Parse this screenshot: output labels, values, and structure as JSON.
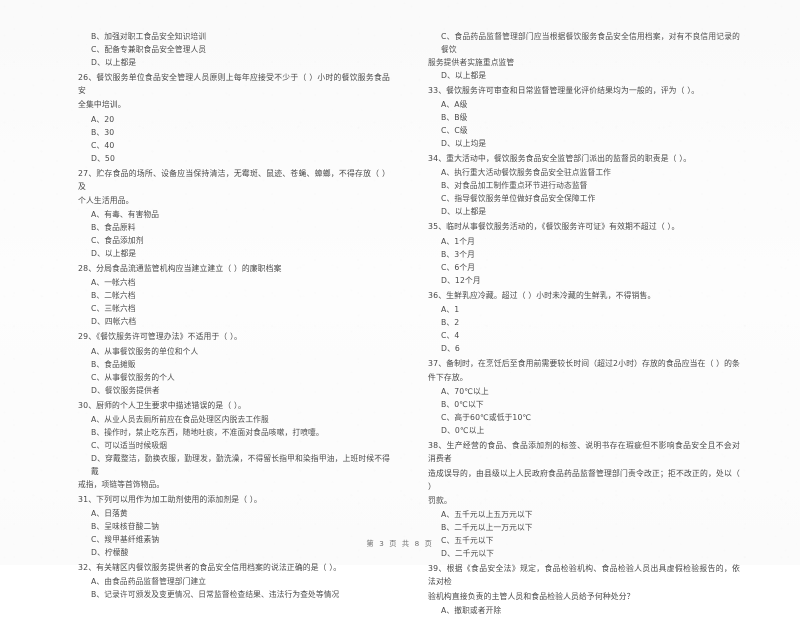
{
  "document": {
    "kind": "scanned-exam-page",
    "language": "zh-CN",
    "footer": {
      "prefix": "第",
      "page_number": "3",
      "middle": "页 共",
      "total_pages": "8",
      "suffix": "页",
      "full_text": "第 3 页 共 8 页"
    }
  },
  "columns": [
    {
      "id": "left-column",
      "blocks": [
        {
          "type": "options-continued",
          "options": [
            "B、加强对职工食品安全知识培训",
            "C、配备专兼职食品安全管理人员",
            "D、以上都是"
          ]
        },
        {
          "type": "question",
          "number": "26",
          "stem": "26、餐饮服务单位食品安全管理人员原则上每年应接受不少于（      ）小时的餐饮服务食品安",
          "stem_cont": "全集中培训。",
          "options": [
            "A、20",
            "B、30",
            "C、40",
            "D、50"
          ]
        },
        {
          "type": "question",
          "number": "27",
          "stem": "27、贮存食品的场所、设备应当保持清洁，无霉斑、鼠迹、苍蝇、蟑螂，不得存放（      ）及",
          "stem_cont": "个人生活用品。",
          "options": [
            "A、有毒、有害物品",
            "B、食品原料",
            "C、食品添加剂",
            "D、以上都是"
          ]
        },
        {
          "type": "question",
          "number": "28",
          "stem": "28、分局食品流通监管机构应当建立建立（      ）的廉职档案",
          "options": [
            "A、一帐六档",
            "B、二帐六档",
            "C、三帐六档",
            "D、四帐六档"
          ]
        },
        {
          "type": "question",
          "number": "29",
          "stem": "29、《餐饮服务许可管理办法》不适用于（      ）。",
          "options": [
            "A、从事餐饮服务的单位和个人",
            "B、食品摊贩",
            "C、从事餐饮服务的个人",
            "D、餐饮服务提供者"
          ]
        },
        {
          "type": "question",
          "number": "30",
          "stem": "30、厨师的个人卫生要求中描述错误的是（      ）。",
          "options": [
            "A、从业人员去厕所前应在食品处理区内脱去工作服",
            "B、操作时，禁止吃东西，随地吐痰，不准面对食品咳嗽，打喷嚏。",
            "C、可以适当时候吸烟",
            "D、穿戴整洁，勤换衣服，勤理发，勤洗澡，不得留长指甲和染指甲油，上班时候不得戴"
          ],
          "option_cont": "戒指，项链等首饰物品。"
        },
        {
          "type": "question",
          "number": "31",
          "stem": "31、下列可以用作为加工助剂使用的添加剂是（      ）。",
          "options": [
            "A、日落黄",
            "B、呈味核苷酸二钠",
            "C、羧甲基纤维素钠",
            "D、柠檬酸"
          ]
        },
        {
          "type": "question",
          "number": "32",
          "stem": "32、有关辖区内餐饮服务提供者的食品安全信用档案的说法正确的是（      ）。",
          "options": [
            "A、由食品药品监督管理部门建立",
            "B、记录许可颁发及变更情况、日常监督检查结果、违法行为查处等情况"
          ]
        }
      ]
    },
    {
      "id": "right-column",
      "blocks": [
        {
          "type": "options-continued",
          "options": [
            "C、食品药品监督管理部门应当根据餐饮服务食品安全信用档案，对有不良信用记录的餐饮"
          ],
          "option_cont": "服务提供者实施重点监管",
          "options_after": [
            "D、以上都是"
          ]
        },
        {
          "type": "question",
          "number": "33",
          "stem": "33、餐饮服务许可审查和日常监督管理量化评价结果均为一般的，评为（      ）。",
          "options": [
            "A、A级",
            "B、B级",
            "C、C级",
            "D、以上均是"
          ]
        },
        {
          "type": "question",
          "number": "34",
          "stem": "34、重大活动中，餐饮服务食品安全监管部门派出的监督员的职责是（      ）。",
          "options": [
            "A、执行重大活动餐饮服务食品安全驻点监督工作",
            "B、对食品加工制作重点环节进行动态监督",
            "C、指导餐饮服务单位做好食品安全保障工作",
            "D、以上都是"
          ]
        },
        {
          "type": "question",
          "number": "35",
          "stem": "35、临时从事餐饮服务活动的，《餐饮服务许可证》有效期不超过（      ）。",
          "options": [
            "A、1个月",
            "B、3个月",
            "C、6个月",
            "D、12个月"
          ]
        },
        {
          "type": "question",
          "number": "36",
          "stem": "36、生鲜乳应冷藏。超过（      ）小时未冷藏的生鲜乳，不得销售。",
          "options": [
            "A、1",
            "B、2",
            "C、4",
            "D、6"
          ]
        },
        {
          "type": "question",
          "number": "37",
          "stem": "37、备制时，在烹饪后至食用前需要较长时间（超过2小时）存放的食品应当在（      ）的条",
          "stem_cont": "件下存放。",
          "options": [
            "A、70℃以上",
            "B、0℃以下",
            "C、高于60℃或低于10℃",
            "D、0℃以上"
          ]
        },
        {
          "type": "question",
          "number": "38",
          "stem": "38、生产经营的食品、食品添加剂的标签、说明书存在瑕疵但不影响食品安全且不会对消费者",
          "stem_cont": "造成误导的，由县级以上人民政府食品药品监督管理部门责令改正；拒不改正的，处以（      ）",
          "stem_cont2": "罚款。",
          "options": [
            "A、五千元以上五万元以下",
            "B、二千元以上一万元以下",
            "C、五千元以下",
            "D、二千元以下"
          ]
        },
        {
          "type": "question",
          "number": "39",
          "stem": "39、根据《食品安全法》规定，食品检验机构、食品检验人员出具虚假检验报告的，依法对检",
          "stem_cont": "验机构直接负责的主管人员和食品检验人员给予何种处分？",
          "options": [
            "A、撤职或者开除"
          ]
        }
      ]
    }
  ]
}
